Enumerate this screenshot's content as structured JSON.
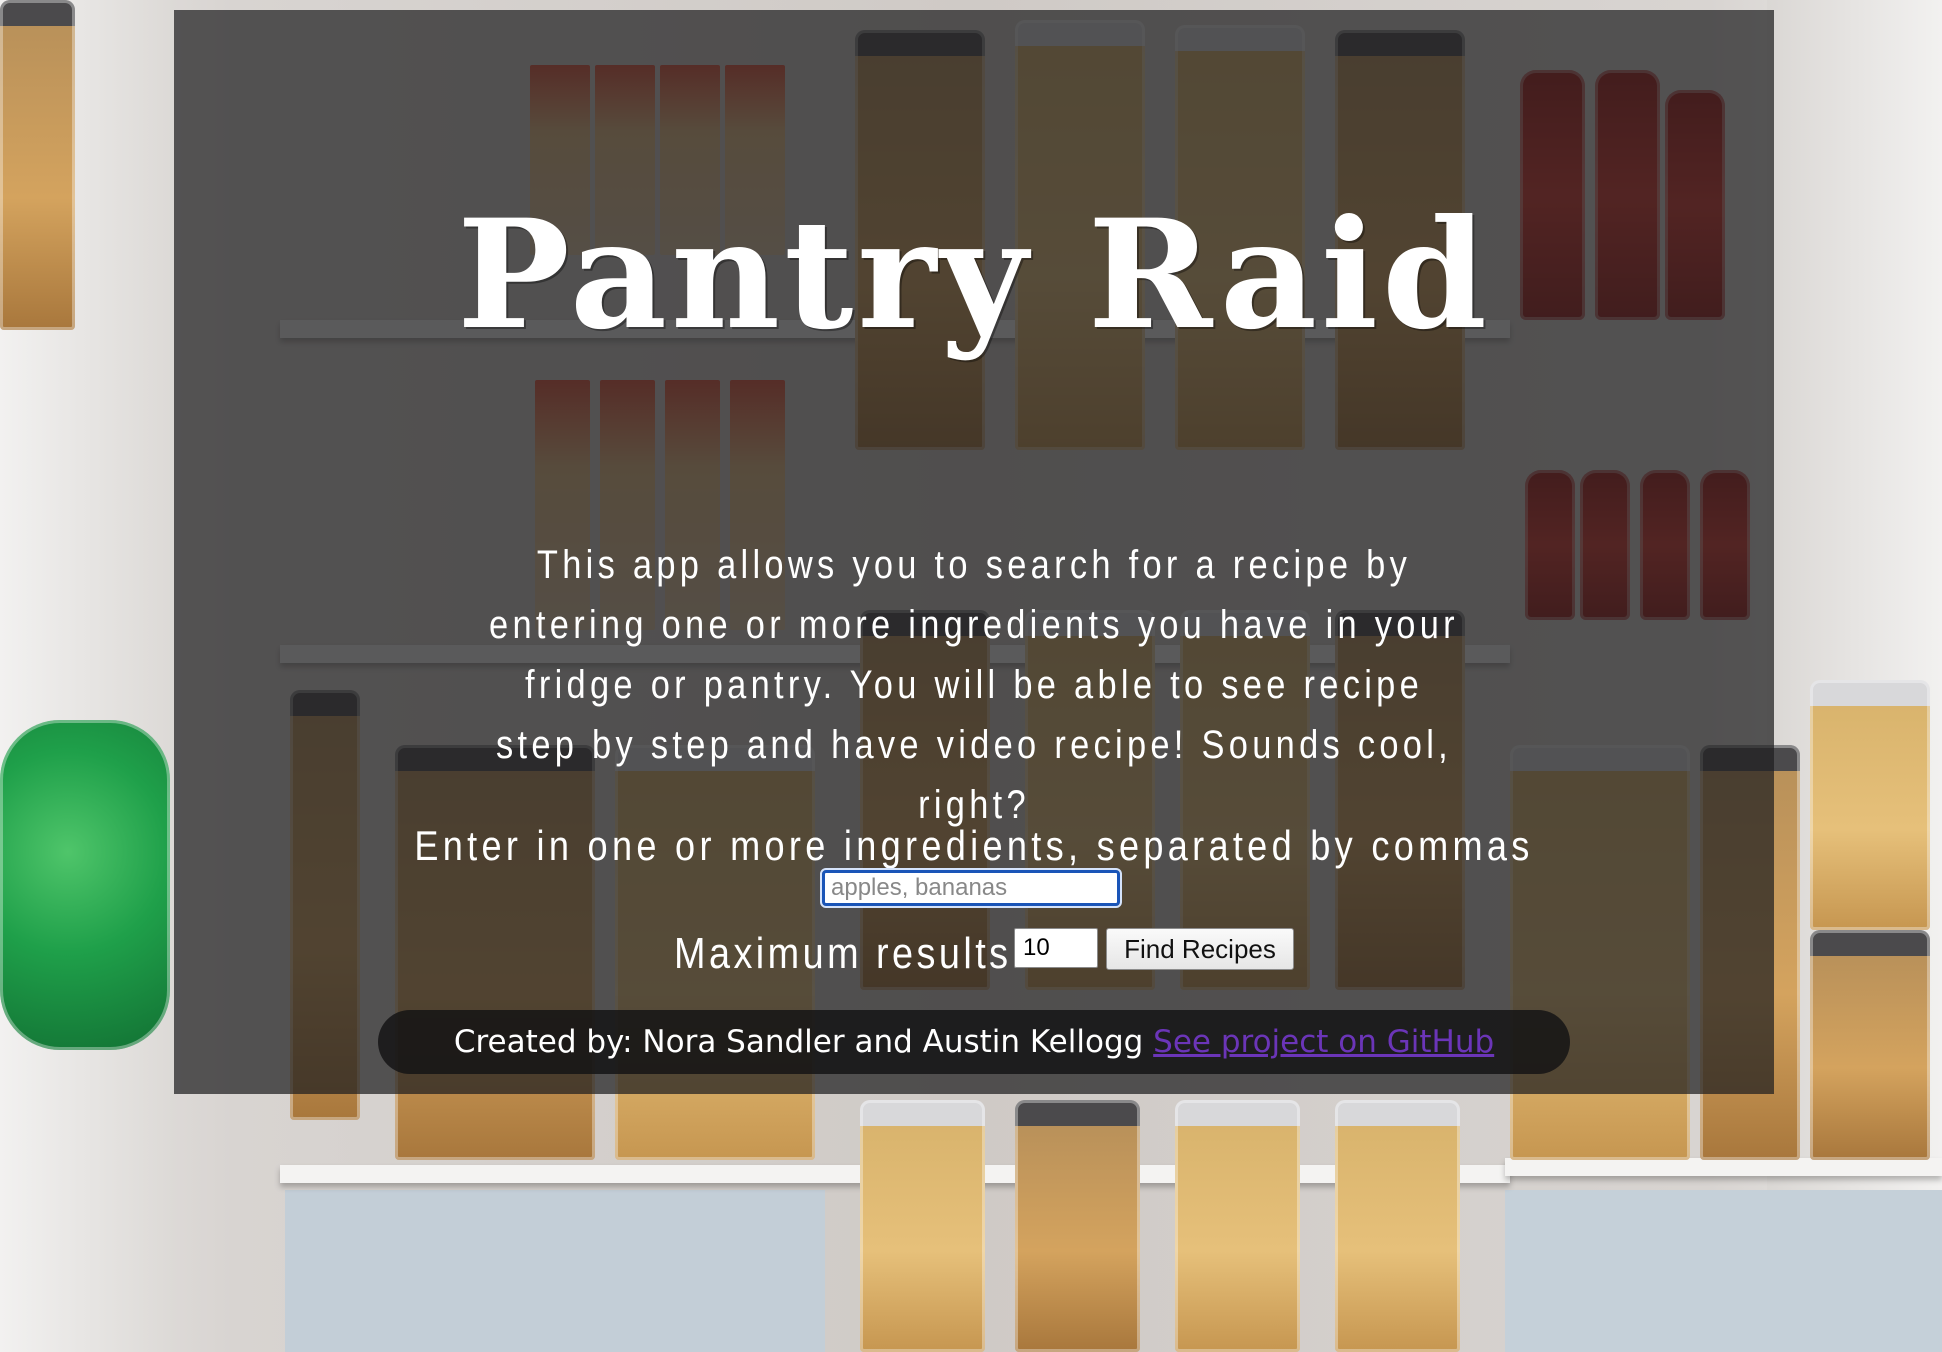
{
  "app": {
    "title": "Pantry Raid",
    "description": "This app allows you to search for a recipe by entering one or more ingredients you have in your fridge or pantry. You will be able to see recipe step by step and have video recipe! Sounds cool, right?"
  },
  "form": {
    "ingredients_label": "Enter in one or more ingredients, separated by commas",
    "ingredients_placeholder": "apples, bananas",
    "ingredients_value": "",
    "max_results_label": "Maximum results:",
    "max_results_value": "10",
    "submit_label": "Find Recipes"
  },
  "footer": {
    "credits": "Created by: Nora Sandler and Austin Kellogg",
    "github_link": "See project on GitHub",
    "link_color": "#6b35b8"
  },
  "colors": {
    "panel_bg": "rgba(30, 30, 32, 0.72)",
    "text": "#ffffff",
    "input_focus_border": "#1a55b8"
  }
}
